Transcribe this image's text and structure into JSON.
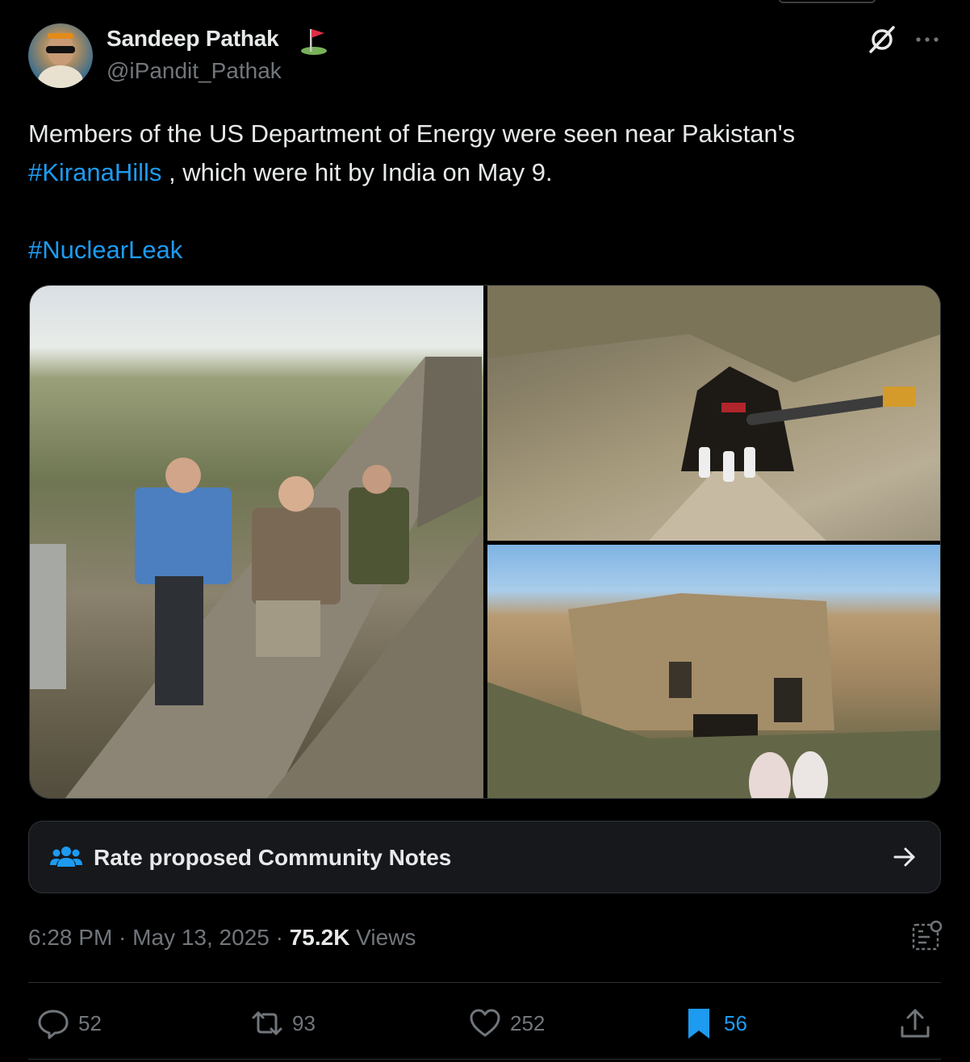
{
  "author": {
    "name": "Sandeep Pathak",
    "handle": "@iPandit_Pathak",
    "avatar_icon": "profile-avatar",
    "badge_icon": "golf-flag-emoji"
  },
  "header_icons": {
    "grok": "grok-icon",
    "more": "more-horizontal-icon"
  },
  "post": {
    "line1": "Members of the US Department of Energy were seen near Pakistan's",
    "hashtag1": "#KiranaHills",
    "line2_rest": " , which were hit by India on May 9.",
    "hashtag2": "#NuclearLeak"
  },
  "media": [
    {
      "alt": "People in masks walking in a concrete trench on a grassy hill"
    },
    {
      "alt": "People in white protective suits exiting a tunnel in a rocky hillside"
    },
    {
      "alt": "Bunker entrance carved into a hillside with people in white suits"
    }
  ],
  "community_notes": {
    "label": "Rate proposed Community Notes",
    "icon": "people-group-icon",
    "arrow": "right-arrow-icon"
  },
  "meta": {
    "time": "6:28 PM",
    "sep1": " · ",
    "date": "May 13, 2025",
    "sep2": " · ",
    "views_count": "75.2K",
    "views_label": " Views"
  },
  "actions": {
    "replies": "52",
    "reposts": "93",
    "likes": "252",
    "bookmarks": "56"
  },
  "colors": {
    "background": "#000000",
    "text": "#e7e9ea",
    "muted": "#71767b",
    "link": "#1d9bf0",
    "border": "#2f3336"
  }
}
